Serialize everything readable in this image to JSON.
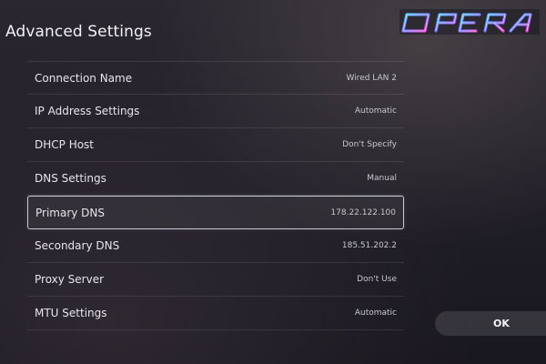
{
  "header": {
    "title": "Advanced Settings"
  },
  "logo": {
    "text": "OPERA",
    "icon": "opera-logo-watermark"
  },
  "settings": [
    {
      "label": "Connection Name",
      "value": "Wired LAN 2"
    },
    {
      "label": "IP Address Settings",
      "value": "Automatic"
    },
    {
      "label": "DHCP Host",
      "value": "Don't Specify"
    },
    {
      "label": "DNS Settings",
      "value": "Manual"
    },
    {
      "label": "Primary DNS",
      "value": "178.22.122.100",
      "focused": true
    },
    {
      "label": "Secondary DNS",
      "value": "185.51.202.2"
    },
    {
      "label": "Proxy Server",
      "value": "Don't Use"
    },
    {
      "label": "MTU Settings",
      "value": "Automatic"
    }
  ],
  "actions": {
    "ok_label": "OK"
  },
  "colors": {
    "background": "#24212b",
    "text": "#e8e8ec",
    "focus_border": "#e6e6f0",
    "logo_blue": "#3ec4ff",
    "logo_pink": "#ff3cc8"
  }
}
